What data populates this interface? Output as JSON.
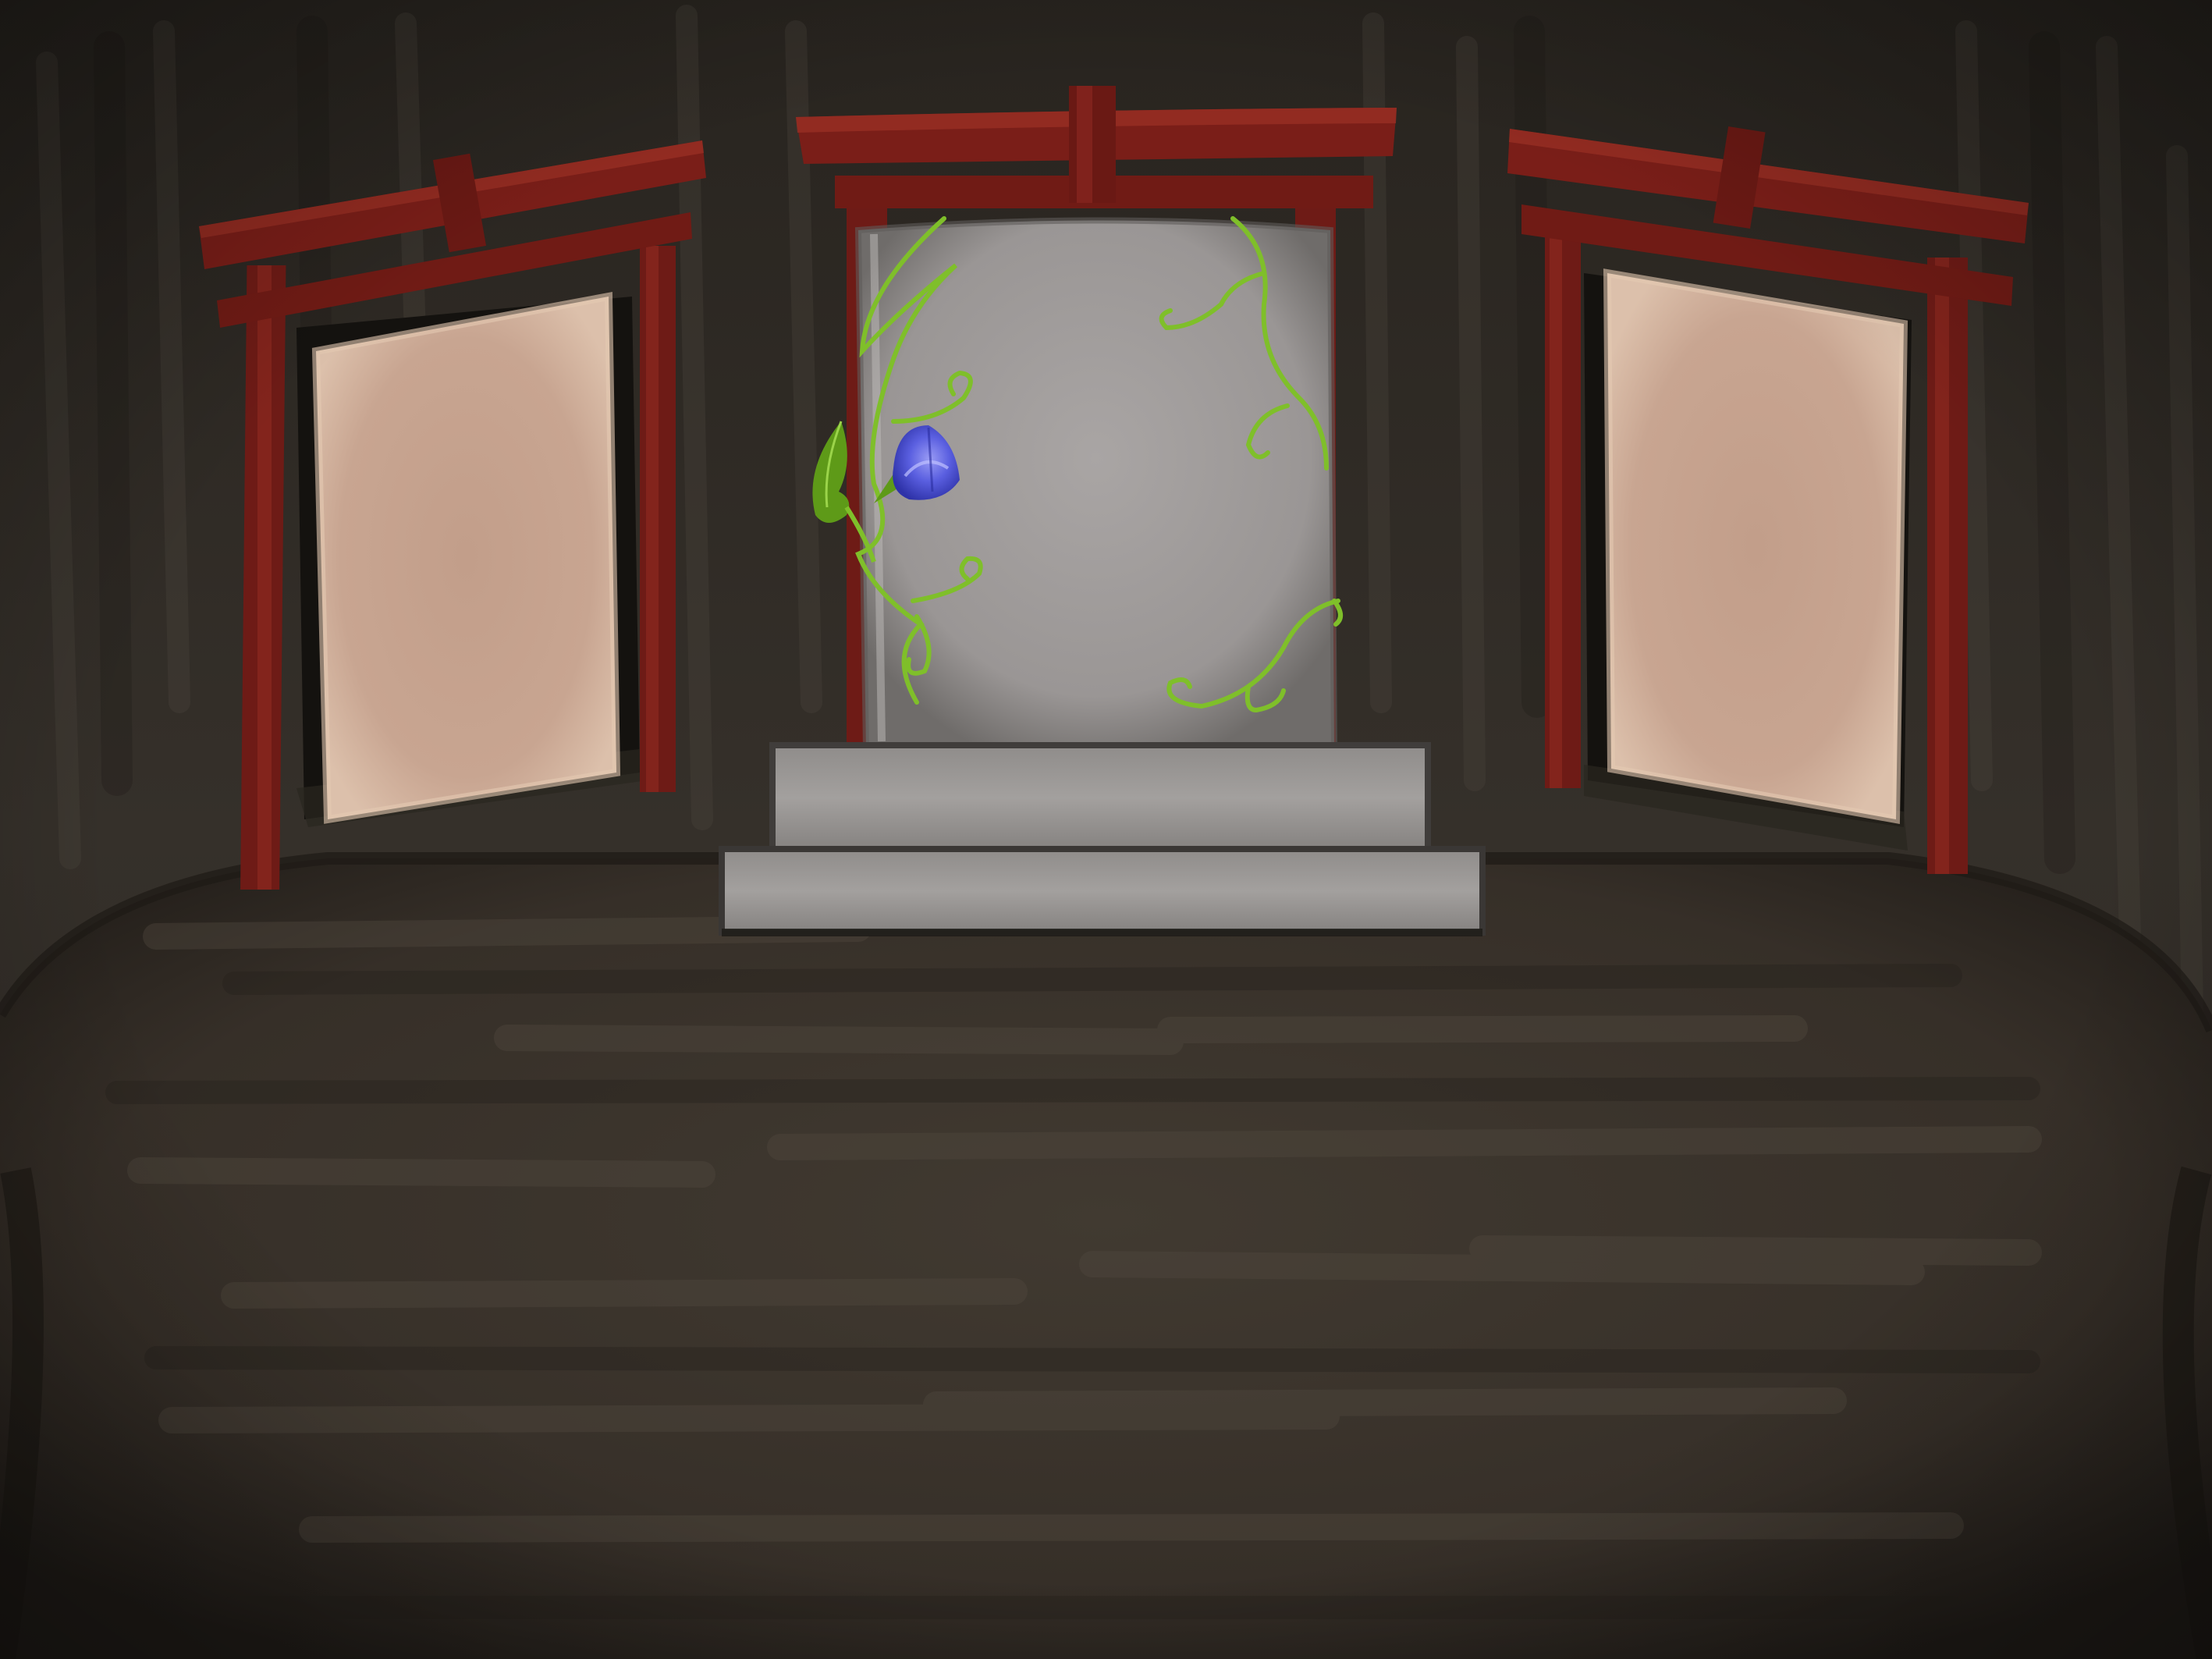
{
  "scene": {
    "name": "shrine-room",
    "palette": {
      "wall_dark": "#2e2a25",
      "wall_light": "#3c3731",
      "floor_base": "#3a342d",
      "floor_stroke": "#4a4238",
      "torii_red": "#7a1e18",
      "torii_red_light": "#8e2a22",
      "torii_shadow": "#4e120e",
      "panel_outer": "#d9b8a2",
      "panel_inner": "#c4a08c",
      "doorway_shadow": "#15130f",
      "stone_light": "#b2aeac",
      "stone_mid": "#9a9695",
      "stone_dark": "#6d6a68",
      "vine_green": "#7fbf2a",
      "leaf_green": "#5e9a18",
      "flower_blue": "#4a4fd9",
      "flower_light": "#8a8cf0"
    },
    "gates": [
      {
        "id": "left",
        "icon": "torii-gate-icon"
      },
      {
        "id": "center",
        "icon": "torii-gate-icon"
      },
      {
        "id": "right",
        "icon": "torii-gate-icon"
      }
    ],
    "center_object": "stone-monument",
    "decoration": [
      "vines",
      "morning-glory-flower"
    ]
  }
}
